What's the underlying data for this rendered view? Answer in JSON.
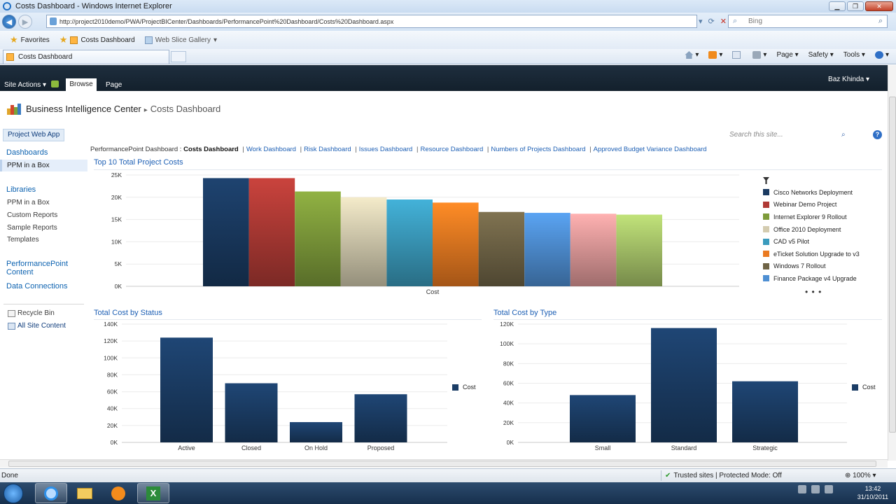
{
  "window": {
    "title": "Costs Dashboard - Windows Internet Explorer"
  },
  "browser": {
    "url": "http://project2010demo/PWA/ProjectBICenter/Dashboards/PerformancePoint%20Dashboard/Costs%20Dashboard.aspx",
    "search_placeholder": "Bing",
    "favorites_label": "Favorites",
    "fav_link_1": "Costs Dashboard",
    "fav_link_2": "Web Slice Gallery",
    "tab_label": "Costs Dashboard",
    "cmd_page": "Page",
    "cmd_safety": "Safety",
    "cmd_tools": "Tools"
  },
  "sharepoint": {
    "site_actions": "Site Actions",
    "tab_browse": "Browse",
    "tab_page": "Page",
    "user": "Baz Khinda",
    "breadcrumb_site": "Business Intelligence Center",
    "breadcrumb_page": "Costs Dashboard",
    "top_tab": "Project Web App",
    "search_placeholder": "Search this site...",
    "quicklaunch": {
      "dashboards": "Dashboards",
      "ppm_box_selected": "PPM in a Box",
      "libraries": "Libraries",
      "ppm_box": "PPM in a Box",
      "custom_reports": "Custom Reports",
      "sample_reports": "Sample Reports",
      "templates": "Templates",
      "pp_content_1": "PerformancePoint",
      "pp_content_2": "Content",
      "data_connections": "Data Connections",
      "recycle_bin": "Recycle Bin",
      "all_site_content": "All Site Content"
    },
    "dash_nav": {
      "prefix": "PerformancePoint Dashboard :",
      "current": "Costs Dashboard",
      "links": [
        "Work Dashboard",
        "Risk Dashboard",
        "Issues Dashboard",
        "Resource Dashboard",
        "Numbers of Projects Dashboard",
        "Approved Budget Variance Dashboard"
      ]
    }
  },
  "colors": {
    "top10": [
      "#1a3a61",
      "#b03a35",
      "#7e9b3a",
      "#d4ccb0",
      "#3a9bbd",
      "#ea7a21",
      "#6f6446",
      "#4e8fd3",
      "#e29a9a",
      "#a8c56a"
    ],
    "series": "#1b3d66"
  },
  "chart_data": [
    {
      "type": "bar",
      "title": "Top 10 Total Project Costs",
      "categories": [
        "Cost"
      ],
      "series": [
        {
          "name": "Cisco Networks Deployment",
          "values": [
            24300
          ]
        },
        {
          "name": "Webinar Demo Project",
          "values": [
            24300
          ]
        },
        {
          "name": "Internet Explorer 9 Rollout",
          "values": [
            21300
          ]
        },
        {
          "name": "Office 2010 Deployment",
          "values": [
            20000
          ]
        },
        {
          "name": "CAD v5 Pilot",
          "values": [
            19500
          ]
        },
        {
          "name": "eTicket Solution Upgrade to v3",
          "values": [
            18800
          ]
        },
        {
          "name": "Windows 7 Rollout",
          "values": [
            16700
          ]
        },
        {
          "name": "Finance Package v4 Upgrade",
          "values": [
            16500
          ]
        },
        {
          "name": "",
          "values": [
            16300
          ]
        },
        {
          "name": "",
          "values": [
            16100
          ]
        }
      ],
      "legend_visible_count": 8,
      "ylim": [
        0,
        25000
      ],
      "yticks": [
        "0K",
        "5K",
        "10K",
        "15K",
        "20K",
        "25K"
      ],
      "legend": "right",
      "grid": true
    },
    {
      "type": "bar",
      "title": "Total Cost by Status",
      "categories": [
        "Active",
        "Closed",
        "On Hold",
        "Proposed"
      ],
      "series": [
        {
          "name": "Cost",
          "values": [
            124000,
            70000,
            24000,
            57000
          ]
        }
      ],
      "ylim": [
        0,
        140000
      ],
      "yticks": [
        "0K",
        "20K",
        "40K",
        "60K",
        "80K",
        "100K",
        "120K",
        "140K"
      ],
      "legend": "right",
      "grid": true
    },
    {
      "type": "bar",
      "title": "Total Cost by Type",
      "categories": [
        "Small",
        "Standard",
        "Strategic"
      ],
      "series": [
        {
          "name": "Cost",
          "values": [
            48000,
            116000,
            62000
          ]
        }
      ],
      "ylim": [
        0,
        120000
      ],
      "yticks": [
        "0K",
        "20K",
        "40K",
        "60K",
        "80K",
        "100K",
        "120K"
      ],
      "legend": "right",
      "grid": true
    }
  ],
  "status": {
    "done": "Done",
    "zone": "Trusted sites | Protected Mode: Off",
    "zoom": "100%"
  },
  "taskbar": {
    "time": "13:42",
    "date": "31/10/2011"
  }
}
